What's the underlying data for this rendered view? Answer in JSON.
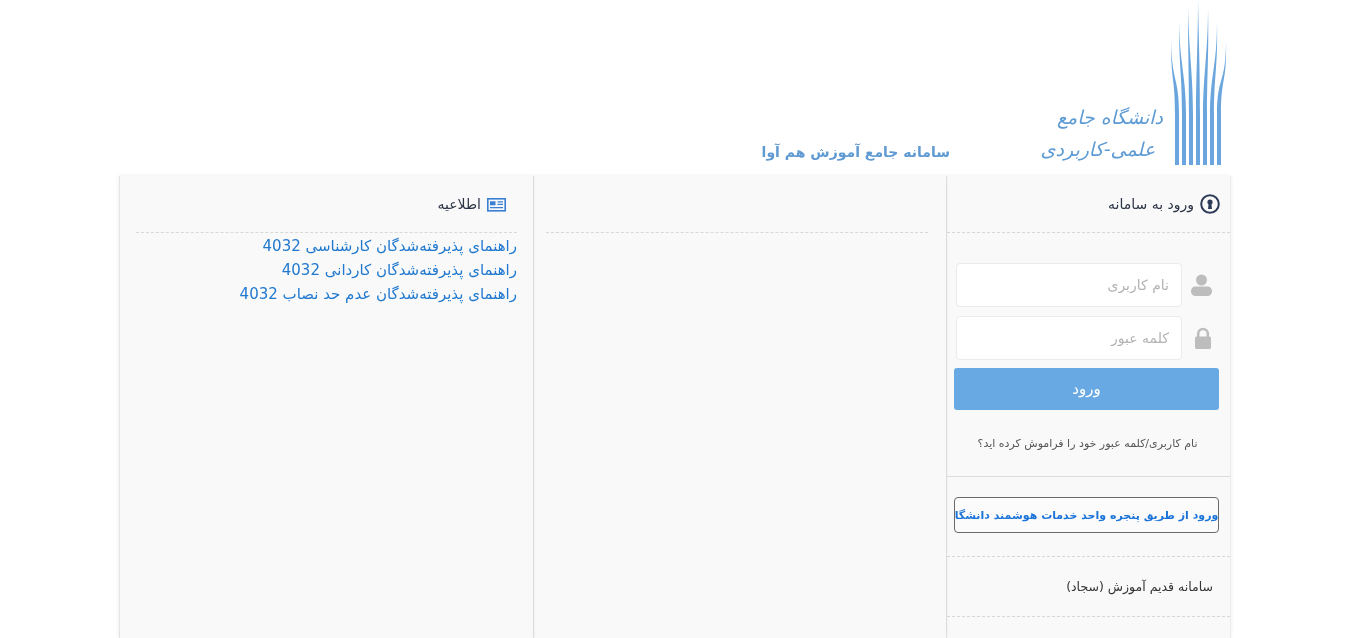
{
  "header": {
    "logo_lines": [
      "دانشگاه جامع",
      "علمی-کاربردی"
    ],
    "subtitle": "سامانه جامع آموزش هم آوا"
  },
  "login": {
    "title": "ورود به سامانه",
    "fields": [
      {
        "kind": "user",
        "placeholder": "نام کاربری"
      },
      {
        "kind": "password",
        "placeholder": "کلمه عبور"
      }
    ],
    "submit": "ورود",
    "forgot": "نام کاربری/کلمه عبور خود را فراموش کرده اید؟",
    "sso_button": "ورود از طریق پنجره واحد خدمات هوشمند دانشگا",
    "links": [
      "سامانه قدیم آموزش (سجاد)"
    ]
  },
  "news": {
    "title": "اطلاعیه",
    "items": [
      "راهنمای پذیرفته‌شدگان کارشناسی 4032",
      "راهنمای پذیرفته‌شدگان کاردانی 4032",
      "راهنمای پذیرفته‌شدگان عدم حد نصاب 4032"
    ]
  }
}
